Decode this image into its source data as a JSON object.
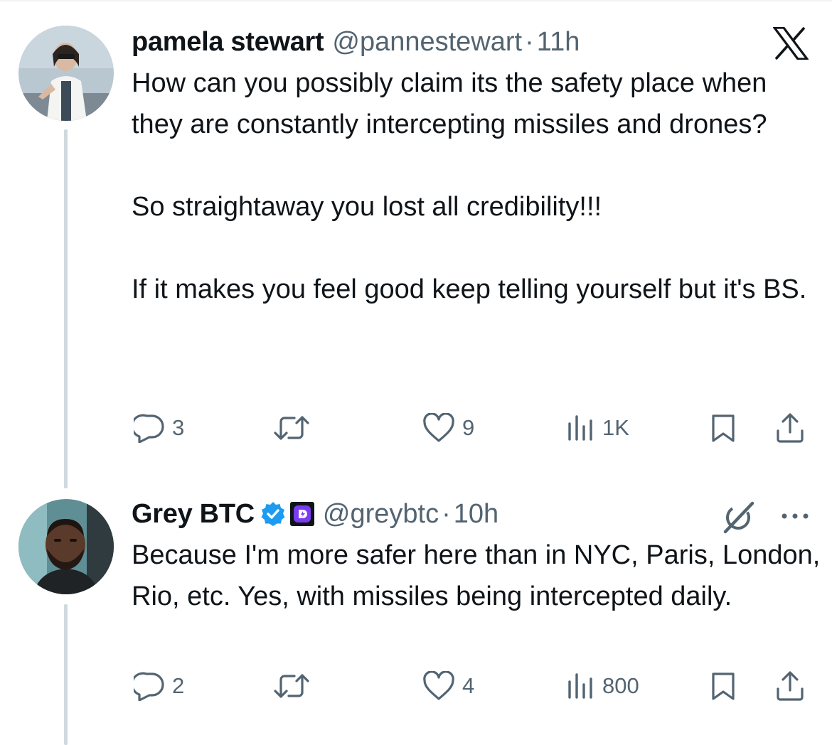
{
  "tweets": [
    {
      "name": "pamela stewart",
      "handle": "@pannestewart",
      "separator": "·",
      "time": "11h",
      "text": "How can you possibly claim its the safety place when they are constantly intercepting missiles and drones?\n\nSo straightaway you lost all credibility!!!\n\nIf it makes you feel good keep telling yourself but it's BS.",
      "replies": "3",
      "retweets": "",
      "likes": "9",
      "views": "1K"
    },
    {
      "name": "Grey BTC",
      "handle": "@greybtc",
      "separator": "·",
      "time": "10h",
      "text": "Because I'm more safer here than in NYC, Paris, London, Rio, etc. Yes, with missiles being intercepted daily.",
      "replies": "2",
      "retweets": "",
      "likes": "4",
      "views": "800"
    }
  ],
  "icons": {
    "platform_logo": "x-logo-icon",
    "verified": "verified-badge-icon",
    "affiliate": "affiliate-d-badge-icon",
    "reply": "reply-icon",
    "retweet": "retweet-icon",
    "like": "heart-icon",
    "views": "views-icon",
    "bookmark": "bookmark-icon",
    "share": "share-icon",
    "grok": "grok-icon",
    "more": "more-icon"
  },
  "colors": {
    "text": "#0f1419",
    "muted": "#536471",
    "verified": "#1d9bf0",
    "thread_line": "#cfd9de"
  }
}
